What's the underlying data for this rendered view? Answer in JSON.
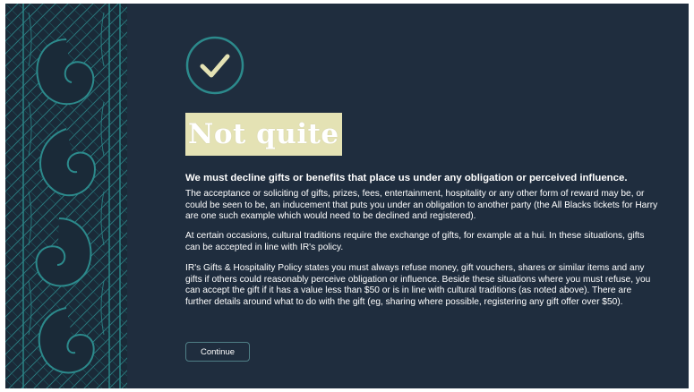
{
  "feedback": {
    "icon": "check-circle-icon",
    "title": "Not quite",
    "lead": "We must decline gifts or benefits that place us under any obligation or perceived influence.",
    "paragraphs": [
      "The acceptance or soliciting of gifts, prizes, fees, entertainment, hospitality or any other form of reward may be, or could be seen to be, an inducement that puts you under an obligation to another party (the All Blacks tickets for Harry are one such example which would need to be declined and registered).",
      "At certain occasions, cultural traditions require the exchange of gifts, for example at a hui. In these situations, gifts can be accepted in line with IR's policy.",
      "IR's Gifts & Hospitality Policy states you must always refuse money, gift vouchers, shares or similar items and any gifts if others could reasonably perceive obligation or influence. Beside these situations where you must refuse, you can accept the gift if it has a value less than $50 or is in line with cultural traditions (as noted above).  There are further details around what to do with the gift (eg, sharing where possible, registering any gift offer over $50)."
    ],
    "continue_label": "Continue"
  },
  "colors": {
    "background": "#1f2d3e",
    "pattern": "#2c8a8c",
    "check": "#e4e2b4",
    "title_highlight": "#e4e2b4",
    "button_border": "#4f7f86"
  }
}
